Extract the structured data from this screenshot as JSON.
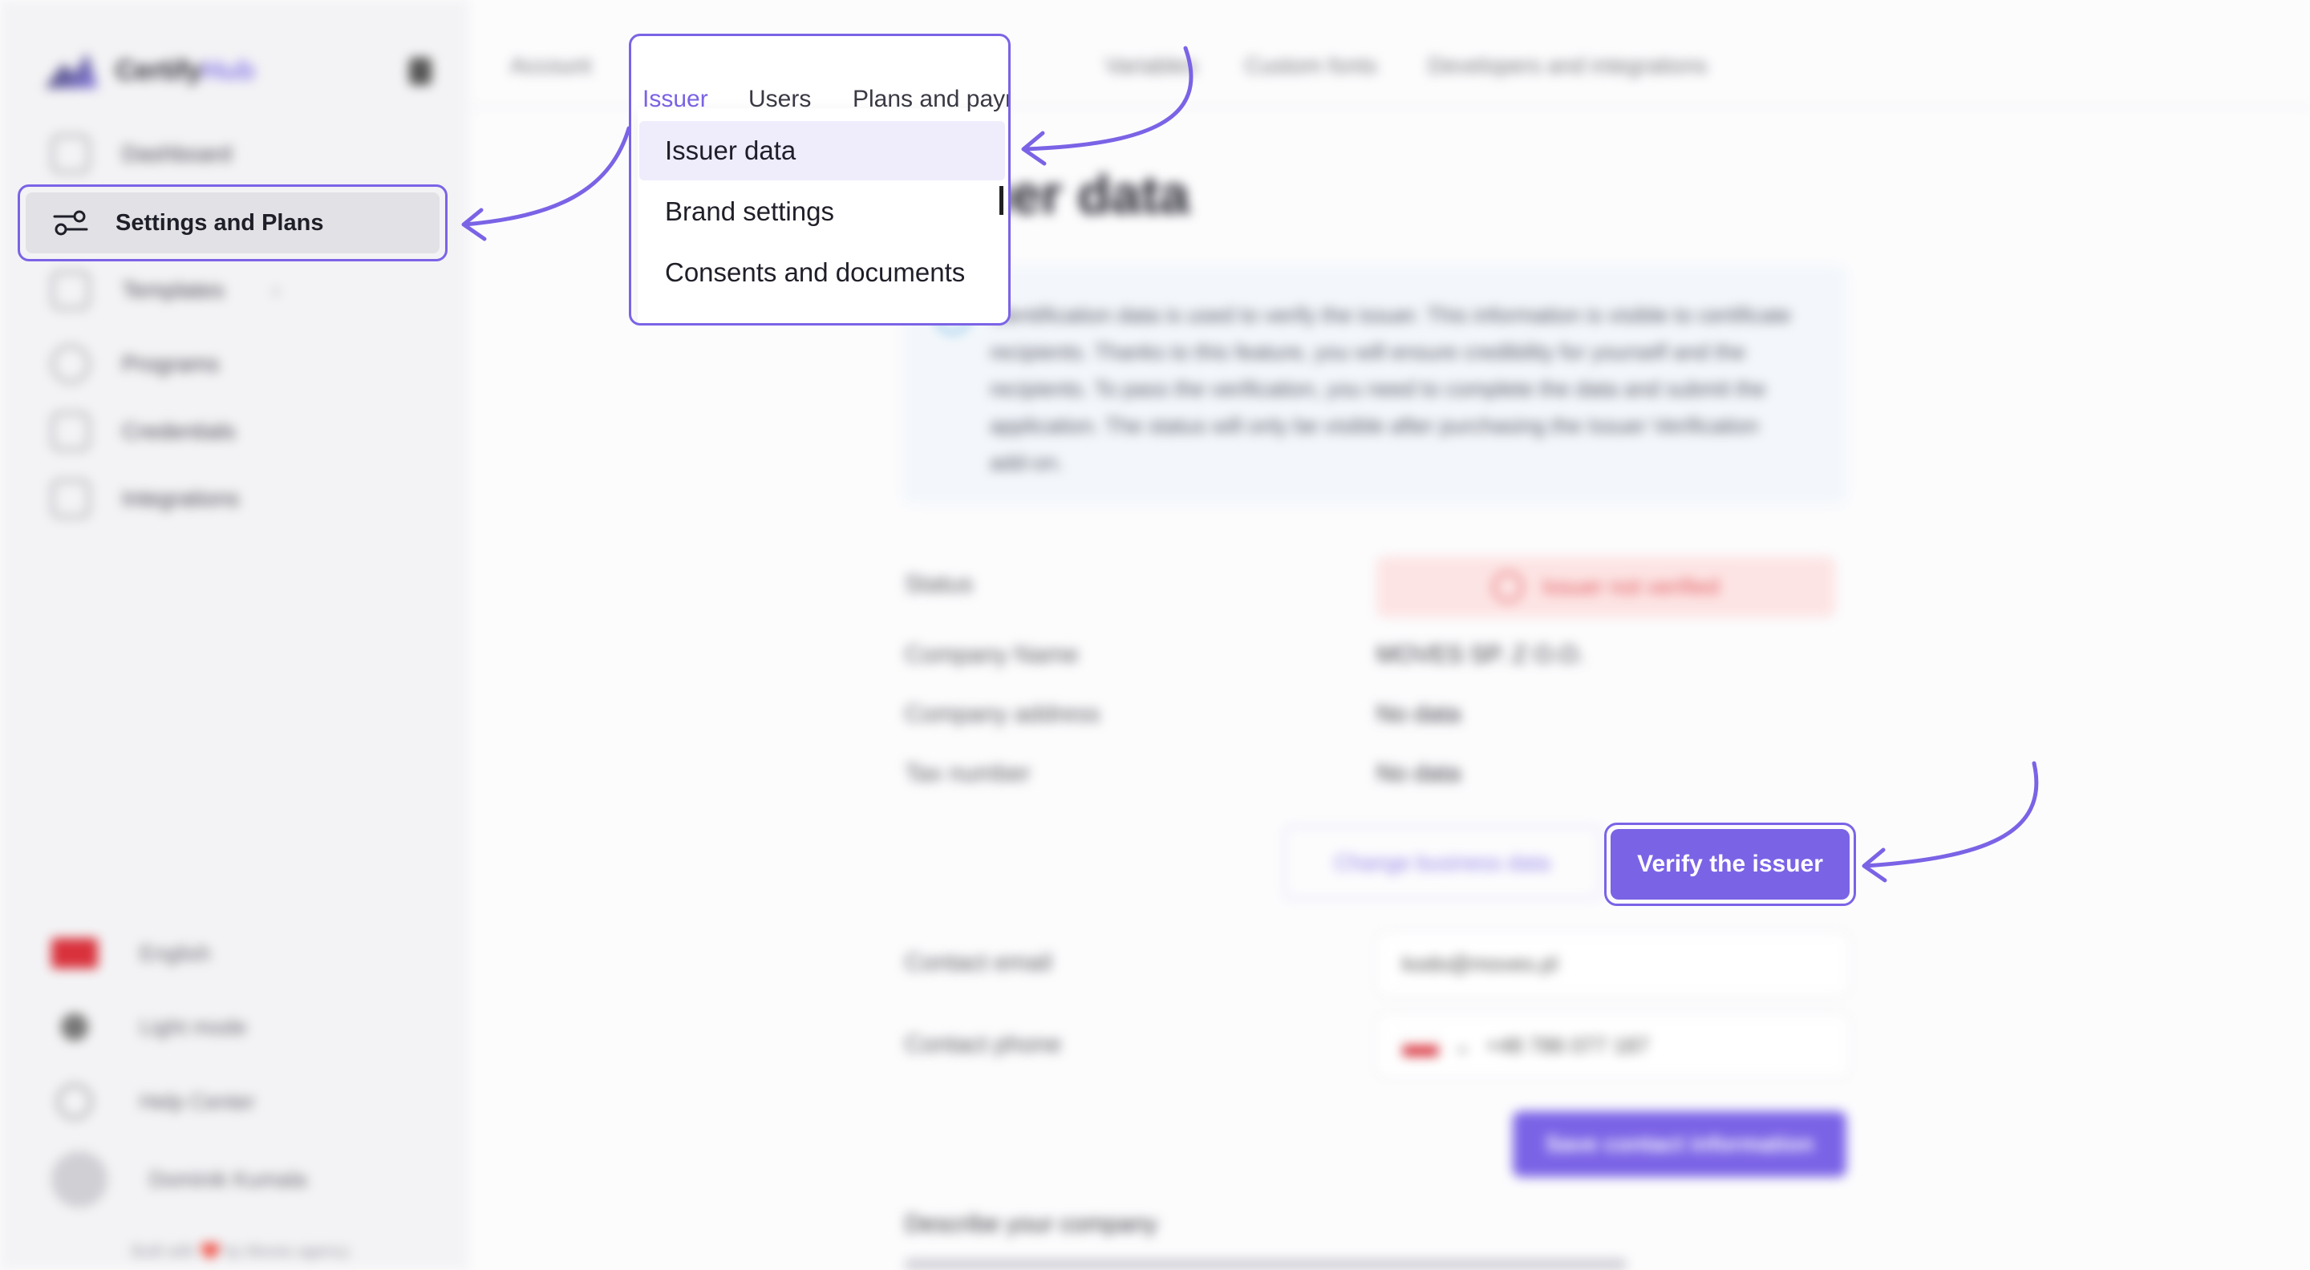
{
  "app": {
    "logo_prefix": "Certify",
    "logo_suffix": "Hub"
  },
  "sidebar": {
    "items": [
      {
        "label": "Dashboard",
        "icon": "home-icon"
      },
      {
        "label": "Settings and Plans",
        "icon": "sliders-icon"
      },
      {
        "label": "Templates",
        "icon": "template-icon"
      },
      {
        "label": "Programs",
        "icon": "users-icon"
      },
      {
        "label": "Credentials",
        "icon": "credential-icon"
      },
      {
        "label": "Integrations",
        "icon": "integration-icon"
      }
    ],
    "bottom": {
      "language": "English",
      "theme": "Light mode",
      "help": "Help Center",
      "user": "Dominik Kumala",
      "built_with": "Built with ❤️ by Moves agency"
    }
  },
  "tabs": {
    "account": "Account",
    "issuer": "Issuer",
    "users": "Users",
    "plans": "Plans and payments",
    "variables": "Variables",
    "custom_fonts": "Custom fonts",
    "developers": "Developers and integrations"
  },
  "dropdown": {
    "items": [
      "Issuer data",
      "Brand settings",
      "Consents and documents"
    ],
    "selected": "Issuer data"
  },
  "main": {
    "title": "Issuer data",
    "info": "Identification data is used to verify the issuer. This information is visible to certificate recipients. Thanks to this feature, you will ensure credibility for yourself and the recipients. To pass the verification, you need to complete the data and submit the application. The status will only be visible after purchasing the Issuer Verification add-on.",
    "rows": {
      "status_label": "Status",
      "status_value": "Issuer not verified",
      "company_name_label": "Company Name",
      "company_name_value": "MOVES SP. Z O.O.",
      "address_label": "Company address",
      "address_value": "No data",
      "tax_label": "Tax number",
      "tax_value": "No data"
    },
    "change_button": "Change business data",
    "verify_button": "Verify the issuer",
    "contact_email_label": "Contact email",
    "contact_email_value": "kodo@moves.pl",
    "contact_phone_label": "Contact phone",
    "contact_phone_value": "+48 786 077 187",
    "save_button": "Save contact information",
    "describe_title": "Describe your company"
  },
  "colors": {
    "accent": "#7b63e6",
    "selected_bg": "#efedfc",
    "danger": "#e0565a"
  }
}
